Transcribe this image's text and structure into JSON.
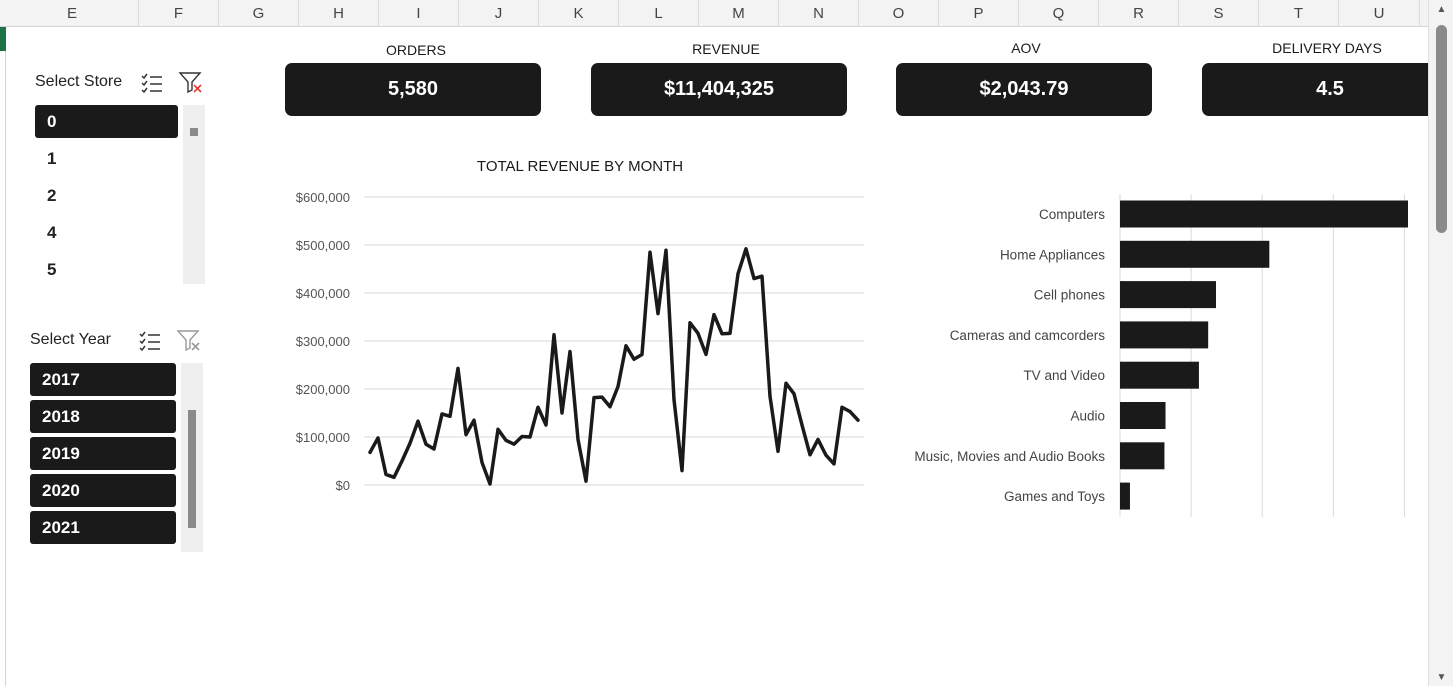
{
  "columns": [
    "E",
    "F",
    "G",
    "H",
    "I",
    "J",
    "K",
    "L",
    "M",
    "N",
    "O",
    "P",
    "Q",
    "R",
    "S",
    "T",
    "U"
  ],
  "store_slicer": {
    "title": "Select Store",
    "items": [
      {
        "label": "0",
        "selected": true
      },
      {
        "label": "1",
        "selected": false
      },
      {
        "label": "2",
        "selected": false
      },
      {
        "label": "4",
        "selected": false
      },
      {
        "label": "5",
        "selected": false
      }
    ]
  },
  "year_slicer": {
    "title": "Select Year",
    "items": [
      {
        "label": "2017",
        "selected": true
      },
      {
        "label": "2018",
        "selected": true
      },
      {
        "label": "2019",
        "selected": true
      },
      {
        "label": "2020",
        "selected": true
      },
      {
        "label": "2021",
        "selected": true
      }
    ]
  },
  "kpis": {
    "orders": {
      "label": "ORDERS",
      "value": "5,580"
    },
    "revenue": {
      "label": "REVENUE",
      "value": "$11,404,325"
    },
    "aov": {
      "label": "AOV",
      "value": "$2,043.79"
    },
    "delivery": {
      "label": "DELIVERY DAYS",
      "value": "4.5"
    }
  },
  "icons": {
    "multi_select": "multi-select-icon",
    "clear_filter": "clear-filter-icon"
  },
  "colors": {
    "accent": "#1a1a1a",
    "clear_filter_x": "#e53935",
    "gridline": "#d9d9d9"
  },
  "chart_data": [
    {
      "type": "line",
      "title": "TOTAL REVENUE BY MONTH",
      "xlabel": "",
      "ylabel": "",
      "ylim": [
        0,
        600000
      ],
      "yticks": [
        "$0",
        "$100,000",
        "$200,000",
        "$300,000",
        "$400,000",
        "$500,000",
        "$600,000"
      ],
      "ytick_values": [
        0,
        100000,
        200000,
        300000,
        400000,
        500000,
        600000
      ],
      "grid": true,
      "series": [
        {
          "values": [
            68000,
            98000,
            22000,
            16000,
            50000,
            87000,
            133000,
            85000,
            75000,
            148000,
            143000,
            243000,
            105000,
            135000,
            47000,
            2000,
            116000,
            93000,
            85000,
            101000,
            100000,
            162000,
            125000,
            313000,
            150000,
            278000,
            95000,
            8000,
            182000,
            183000,
            163000,
            205000,
            290000,
            262000,
            272000,
            485000,
            357000,
            489000,
            178000,
            30000,
            338000,
            316000,
            272000,
            355000,
            315000,
            316000,
            440000,
            492000,
            430000,
            435000,
            185000,
            70000,
            212000,
            190000,
            125000,
            63000,
            95000,
            62000,
            44000,
            162000,
            153000,
            135000
          ]
        }
      ]
    },
    {
      "type": "bar",
      "orientation": "horizontal",
      "title": "",
      "categories": [
        "Computers",
        "Home Appliances",
        "Cell phones",
        "Cameras and camcorders",
        "TV and Video",
        "Audio",
        "Music, Movies and Audio Books",
        "Games and Toys"
      ],
      "values": [
        4050000,
        2100000,
        1350000,
        1240000,
        1110000,
        640000,
        625000,
        140000
      ],
      "xlim": [
        0,
        4500000
      ],
      "grid": true
    }
  ]
}
